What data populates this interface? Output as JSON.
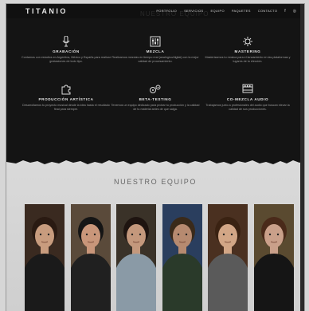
{
  "header": {
    "logo": "TITANIO",
    "title": "NUESTRO EQUIPO",
    "links": [
      "PORTFOLIO",
      "SERVICIOS",
      "EQUIPO",
      "PAQUETES",
      "CONTACTO"
    ],
    "icons": [
      "facebook-icon",
      "instagram-icon"
    ]
  },
  "services": [
    {
      "icon": "microphone-icon",
      "title": "GRABACIÓN",
      "desc": "Contamos con estudios en Argentina, México y España para realizar grabaciones de todo tipo."
    },
    {
      "icon": "mixer-icon",
      "title": "MEZCLA",
      "desc": "Realizamos mezclas en tiempo real (analógico/digital) con la mejor calidad de procesamiento."
    },
    {
      "icon": "mastering-icon",
      "title": "MASTERING",
      "desc": "Masterizamos tu música para el lanzamiento en las plataformas y lugares de tu elección."
    },
    {
      "icon": "puzzle-icon",
      "title": "PRODUCCIÓN ARTÍSTICA",
      "desc": "Desarrollamos tu proyecto musical desde la idea hasta el resultado final para siempre."
    },
    {
      "icon": "gears-icon",
      "title": "BETA-TESTING",
      "desc": "Tenemos un equipo dedicado para probar tu producción y la calidad de tu material antes de que salga."
    },
    {
      "icon": "film-icon",
      "title": "CO-MEZCLA AUDIO",
      "desc": "Trabajamos junto a profesionales del audio que buscan elevar la calidad de sus producciones."
    }
  ],
  "team": {
    "title": "NUESTRO EQUIPO",
    "members": [
      {
        "name": "member-1",
        "bg": "#3a2a20",
        "skin": "#c89c7e",
        "hair": "#2a1a12",
        "shirt": "#1a1a1a"
      },
      {
        "name": "member-2",
        "bg": "#5a4a3a",
        "skin": "#c9967a",
        "hair": "#151515",
        "shirt": "#202020"
      },
      {
        "name": "member-3",
        "bg": "#3a3228",
        "skin": "#c4987c",
        "hair": "#1e1410",
        "shirt": "#8a9aa6"
      },
      {
        "name": "member-4",
        "bg": "#2a3e5e",
        "skin": "#b68a70",
        "hair": "#3a2a1a",
        "shirt": "#2a3a2a"
      },
      {
        "name": "member-5",
        "bg": "#4a3020",
        "skin": "#d2a686",
        "hair": "#3a2212",
        "shirt": "#5a5a5a"
      },
      {
        "name": "member-6",
        "bg": "#5a4a30",
        "skin": "#caa08a",
        "hair": "#4a2a1a",
        "shirt": "#151515"
      }
    ]
  }
}
